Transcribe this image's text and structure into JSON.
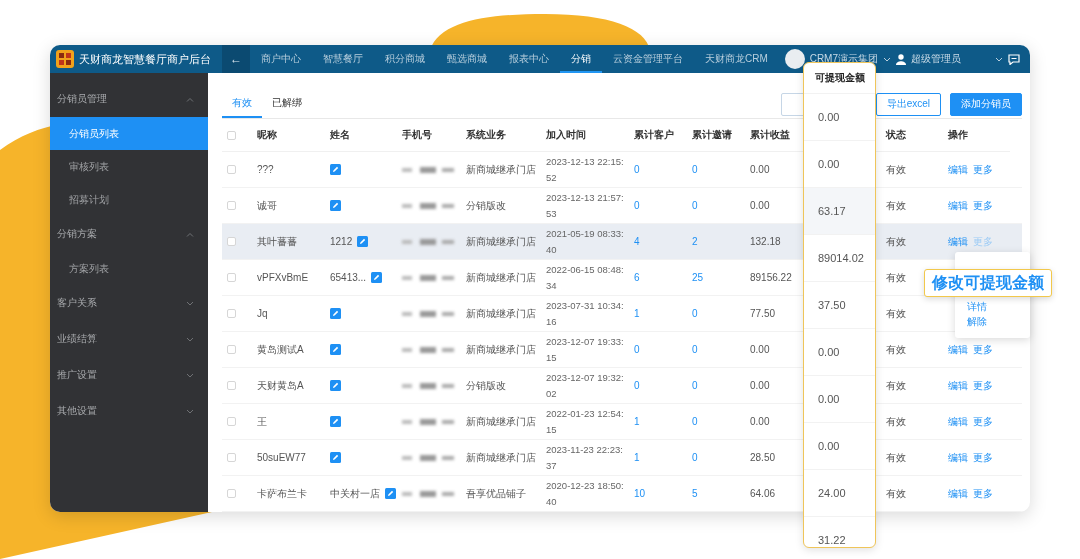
{
  "app": {
    "title": "天财商龙智慧餐厅商户后台",
    "back_glyph": "←"
  },
  "nav": {
    "items": [
      {
        "label": "商户中心",
        "selected": false
      },
      {
        "label": "智慧餐厅",
        "selected": false
      },
      {
        "label": "积分商城",
        "selected": false
      },
      {
        "label": "甄选商城",
        "selected": false
      },
      {
        "label": "报表中心",
        "selected": false
      },
      {
        "label": "分销",
        "selected": true
      },
      {
        "label": "云资金管理平台",
        "selected": false
      },
      {
        "label": "天财商龙CRM",
        "selected": false
      }
    ],
    "org": "CRM7演示集团",
    "user": "超级管理员"
  },
  "sidebar": {
    "groups": [
      {
        "label": "分销员管理",
        "expanded": true,
        "children": [
          {
            "label": "分销员列表",
            "selected": true
          },
          {
            "label": "审核列表",
            "selected": false
          },
          {
            "label": "招募计划",
            "selected": false
          }
        ]
      },
      {
        "label": "分销方案",
        "expanded": true,
        "children": [
          {
            "label": "方案列表",
            "selected": false
          }
        ]
      },
      {
        "label": "客户关系",
        "expanded": false
      },
      {
        "label": "业绩结算",
        "expanded": false
      },
      {
        "label": "推广设置",
        "expanded": false
      },
      {
        "label": "其他设置",
        "expanded": false
      }
    ]
  },
  "tabs": [
    {
      "label": "有效",
      "selected": true
    },
    {
      "label": "已解绑",
      "selected": false
    }
  ],
  "buttons": [
    {
      "label": "导出excel",
      "kind": "outline"
    },
    {
      "label": "添加分销员",
      "kind": "primary"
    }
  ],
  "table": {
    "select_all": {
      "checked": false
    },
    "columns": [
      "昵称",
      "姓名",
      "手机号",
      "系统业务",
      "加入时间",
      "累计客户",
      "累计邀请",
      "累计收益",
      "状态",
      "操作"
    ],
    "rows": [
      {
        "checked": false,
        "hovered": false,
        "nickname": "???",
        "business": "新商城继承门店",
        "joined": "2023-12-13 22:15:52",
        "customers": "0",
        "invites": "0",
        "earnings": "0.00",
        "withdrawable": "0.00",
        "status": "有效",
        "actions": [
          "编辑",
          "更多"
        ]
      },
      {
        "checked": false,
        "hovered": false,
        "nickname": "诚哥",
        "business": "分销版改",
        "joined": "2023-12-13 21:57:53",
        "customers": "0",
        "invites": "0",
        "earnings": "0.00",
        "withdrawable": "0.00",
        "status": "有效",
        "actions": [
          "编辑",
          "更多"
        ]
      },
      {
        "checked": false,
        "hovered": true,
        "nickname": "其叶蕃蕃",
        "name": "1212",
        "business": "新商城继承门店",
        "joined": "2021-05-19 08:33:40",
        "customers": "4",
        "invites": "2",
        "earnings": "132.18",
        "withdrawable": "63.17",
        "status": "有效",
        "actions": [
          "编辑",
          "更多"
        ]
      },
      {
        "checked": false,
        "hovered": false,
        "nickname": "vPFXvBmE",
        "name": "65413...",
        "business": "新商城继承门店",
        "joined": "2022-06-15 08:48:34",
        "customers": "6",
        "invites": "25",
        "earnings": "89156.22",
        "withdrawable": "89014.02",
        "status": "有效"
      },
      {
        "checked": false,
        "hovered": false,
        "nickname": "Jq",
        "business": "新商城继承门店",
        "joined": "2023-07-31 10:34:16",
        "customers": "1",
        "invites": "0",
        "earnings": "77.50",
        "withdrawable": "37.50",
        "status": "有效"
      },
      {
        "checked": false,
        "hovered": false,
        "nickname": "黄岛测试A",
        "business": "新商城继承门店",
        "joined": "2023-12-07 19:33:15",
        "customers": "0",
        "invites": "0",
        "earnings": "0.00",
        "withdrawable": "0.00",
        "status": "有效",
        "actions": [
          "编辑",
          "更多"
        ]
      },
      {
        "checked": false,
        "hovered": false,
        "nickname": "天财黄岛A",
        "business": "分销版改",
        "joined": "2023-12-07 19:32:02",
        "customers": "0",
        "invites": "0",
        "earnings": "0.00",
        "withdrawable": "0.00",
        "status": "有效",
        "actions": [
          "编辑",
          "更多"
        ]
      },
      {
        "checked": false,
        "hovered": false,
        "nickname": "王",
        "business": "新商城继承门店",
        "joined": "2022-01-23 12:54:15",
        "customers": "1",
        "invites": "0",
        "earnings": "0.00",
        "withdrawable": "0.00",
        "status": "有效",
        "actions": [
          "编辑",
          "更多"
        ]
      },
      {
        "checked": false,
        "hovered": false,
        "nickname": "50suEW77",
        "business": "新商城继承门店",
        "joined": "2023-11-23 22:23:37",
        "customers": "1",
        "invites": "0",
        "earnings": "28.50",
        "withdrawable": "24.00",
        "status": "有效",
        "actions": [
          "编辑",
          "更多"
        ]
      },
      {
        "checked": false,
        "hovered": false,
        "nickname": "卡萨布兰卡",
        "name": "中关村一店",
        "business": "吾享优品铺子",
        "joined": "2020-12-23 18:50:40",
        "customers": "10",
        "invites": "5",
        "earnings": "64.06",
        "withdrawable": "31.22",
        "status": "有效",
        "actions": [
          "编辑",
          "更多"
        ]
      }
    ]
  },
  "withdrawable_callout": {
    "title": "可提现金额"
  },
  "more_menu": {
    "items": [
      {
        "label": "修改可提现金额",
        "highlighted": true
      },
      {
        "label": "详情",
        "highlighted": false
      },
      {
        "label": "解除",
        "highlighted": false
      }
    ]
  }
}
